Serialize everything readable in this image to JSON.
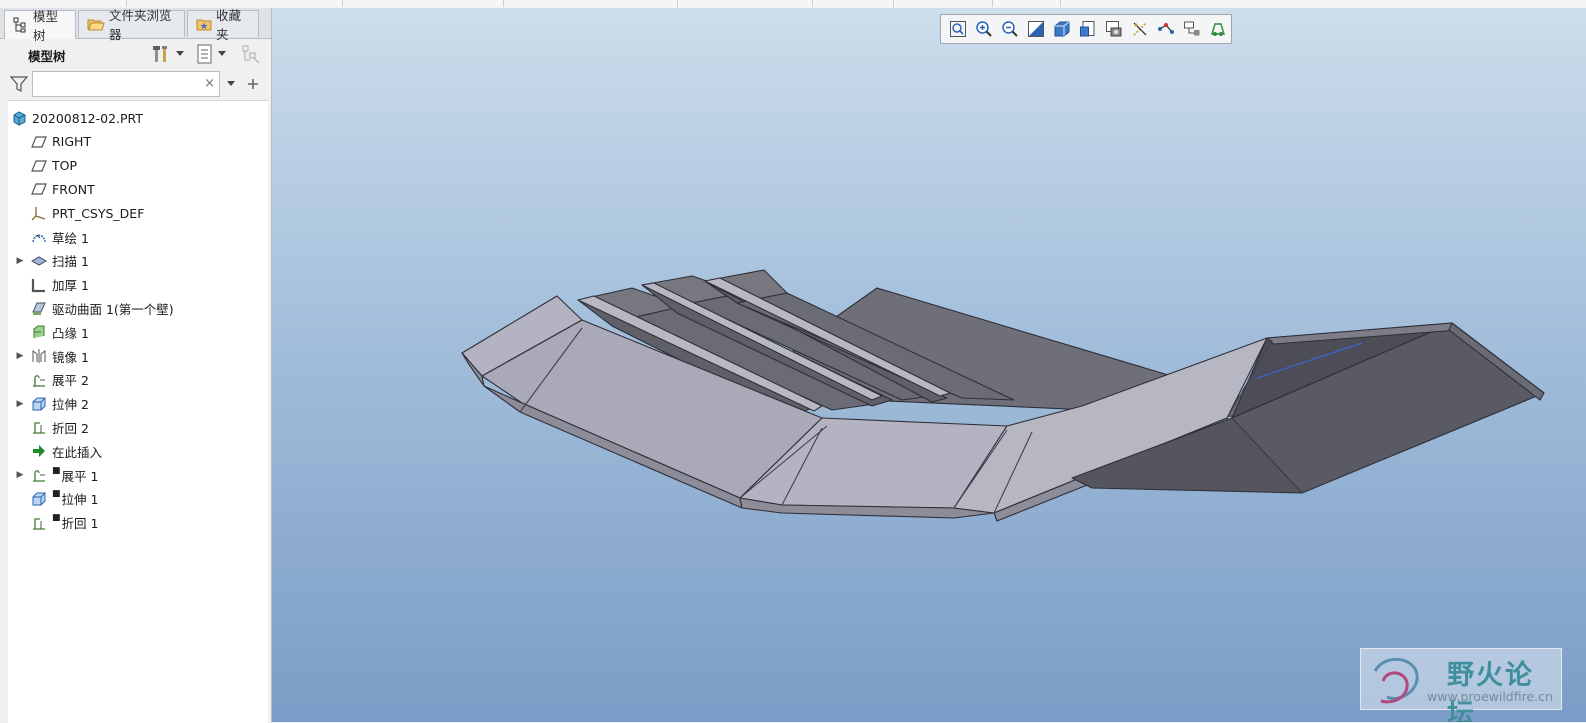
{
  "tabs": [
    {
      "label": "模型树",
      "icon": "model-tree-icon",
      "active": true
    },
    {
      "label": "文件夹浏览器",
      "icon": "folder-browser-icon",
      "active": false
    },
    {
      "label": "收藏夹",
      "icon": "favorites-icon",
      "active": false
    }
  ],
  "panel": {
    "title": "模型树",
    "search": {
      "value": "",
      "placeholder": "",
      "clear": "×"
    }
  },
  "tree": [
    {
      "label": "20200812-02.PRT",
      "icon": "part-icon",
      "expandable": false,
      "level": 0,
      "marked": false
    },
    {
      "label": "RIGHT",
      "icon": "datum-plane-icon",
      "expandable": false,
      "level": 1,
      "marked": false
    },
    {
      "label": "TOP",
      "icon": "datum-plane-icon",
      "expandable": false,
      "level": 1,
      "marked": false
    },
    {
      "label": "FRONT",
      "icon": "datum-plane-icon",
      "expandable": false,
      "level": 1,
      "marked": false
    },
    {
      "label": "PRT_CSYS_DEF",
      "icon": "coordinate-system-icon",
      "expandable": false,
      "level": 1,
      "marked": false
    },
    {
      "label": "草绘 1",
      "icon": "sketch-icon",
      "expandable": false,
      "level": 1,
      "marked": false
    },
    {
      "label": "扫描 1",
      "icon": "sweep-icon",
      "expandable": true,
      "level": 1,
      "marked": false
    },
    {
      "label": "加厚 1",
      "icon": "thicken-icon",
      "expandable": false,
      "level": 1,
      "marked": false
    },
    {
      "label": "驱动曲面 1(第一个壁)",
      "icon": "driving-surface-icon",
      "expandable": false,
      "level": 1,
      "marked": false
    },
    {
      "label": "凸缘 1",
      "icon": "flange-icon",
      "expandable": false,
      "level": 1,
      "marked": false
    },
    {
      "label": "镜像 1",
      "icon": "mirror-icon",
      "expandable": true,
      "level": 1,
      "marked": false
    },
    {
      "label": "展平 2",
      "icon": "unbend-icon",
      "expandable": false,
      "level": 1,
      "marked": false
    },
    {
      "label": "拉伸 2",
      "icon": "extrude-icon",
      "expandable": true,
      "level": 1,
      "marked": false
    },
    {
      "label": "折回 2",
      "icon": "bend-back-icon",
      "expandable": false,
      "level": 1,
      "marked": false
    },
    {
      "label": "在此插入",
      "icon": "insert-here-arrow-icon",
      "expandable": false,
      "level": 1,
      "marked": false
    },
    {
      "label": "展平 1",
      "icon": "unbend-icon",
      "expandable": true,
      "level": 1,
      "marked": true
    },
    {
      "label": "拉伸 1",
      "icon": "extrude-icon",
      "expandable": false,
      "level": 1,
      "marked": true
    },
    {
      "label": "折回 1",
      "icon": "bend-back-icon",
      "expandable": false,
      "level": 1,
      "marked": true
    }
  ],
  "view_toolbar": [
    "refit-icon",
    "zoom-in-icon",
    "zoom-out-icon",
    "repaint-icon",
    "display-style-icon",
    "saved-orientations-icon",
    "view-manager-icon",
    "datum-display-icon",
    "spin-center-icon",
    "annotation-display-icon",
    "appearance-icon"
  ],
  "watermark": {
    "title": "野火论坛",
    "url": "www.proewildfire.cn"
  },
  "colors": {
    "accent": "#3f8f9d",
    "viewport_top": "#cdddeb",
    "viewport_bottom": "#7b9cc6"
  }
}
